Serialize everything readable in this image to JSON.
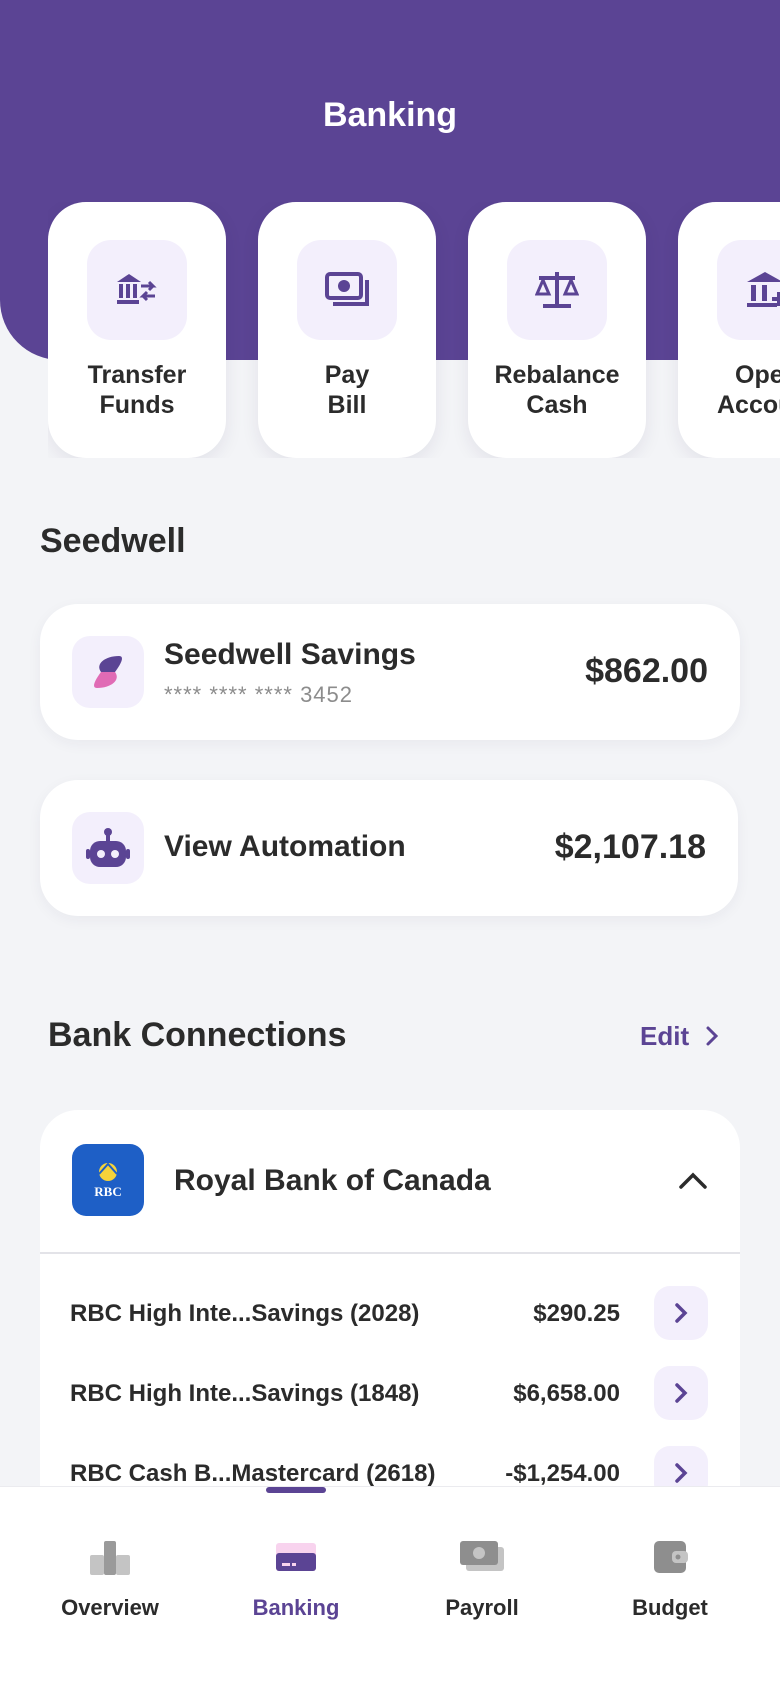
{
  "header": {
    "title": "Banking"
  },
  "quick_actions": [
    {
      "line1": "Transfer",
      "line2": "Funds",
      "icon": "bank-transfer-icon"
    },
    {
      "line1": "Pay",
      "line2": "Bill",
      "icon": "bill-icon"
    },
    {
      "line1": "Rebalance",
      "line2": "Cash",
      "icon": "scale-icon"
    },
    {
      "line1": "Open",
      "line2": "Account",
      "icon": "bank-add-icon"
    }
  ],
  "seedwell": {
    "section_title": "Seedwell",
    "savings": {
      "name": "Seedwell Savings",
      "mask": "**** **** **** 3452",
      "amount": "$862.00"
    },
    "automation": {
      "name": "View Automation",
      "amount": "$2,107.18"
    }
  },
  "connections": {
    "section_title": "Bank Connections",
    "edit_label": "Edit",
    "bank": {
      "name": "Royal Bank of Canada",
      "logo_text": "RBC",
      "accounts": [
        {
          "name": "RBC High Inte...Savings (2028)",
          "amount": "$290.25"
        },
        {
          "name": "RBC High Inte...Savings (1848)",
          "amount": "$6,658.00"
        },
        {
          "name": "RBC Cash B...Mastercard (2618)",
          "amount": "-$1,254.00"
        }
      ]
    }
  },
  "tabs": [
    {
      "label": "Overview",
      "icon": "overview-icon"
    },
    {
      "label": "Banking",
      "icon": "banking-card-icon",
      "active": true
    },
    {
      "label": "Payroll",
      "icon": "payroll-cash-icon"
    },
    {
      "label": "Budget",
      "icon": "wallet-icon"
    }
  ],
  "colors": {
    "brand": "#5B4494",
    "accent_soft": "#F3EFFC",
    "background": "#F3F4F7",
    "bank_logo": "#1E5FC6"
  }
}
